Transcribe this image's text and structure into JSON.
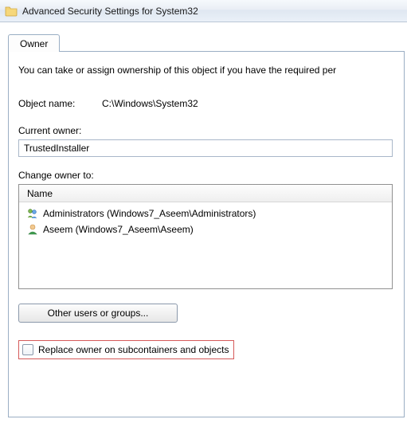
{
  "window": {
    "title": "Advanced Security Settings for System32"
  },
  "tabs": {
    "owner": "Owner"
  },
  "intro": "You can take or assign ownership of this object if you have the required per",
  "object_name": {
    "label": "Object name:",
    "value": "C:\\Windows\\System32"
  },
  "current_owner": {
    "label": "Current owner:",
    "value": "TrustedInstaller"
  },
  "change_owner": {
    "label": "Change owner to:",
    "header": "Name",
    "items": [
      {
        "icon": "group-icon",
        "text": "Administrators (Windows7_Aseem\\Administrators)"
      },
      {
        "icon": "user-icon",
        "text": "Aseem (Windows7_Aseem\\Aseem)"
      }
    ]
  },
  "buttons": {
    "other_users": "Other users or groups..."
  },
  "replace_owner": {
    "label": "Replace owner on subcontainers and objects",
    "checked": false
  }
}
